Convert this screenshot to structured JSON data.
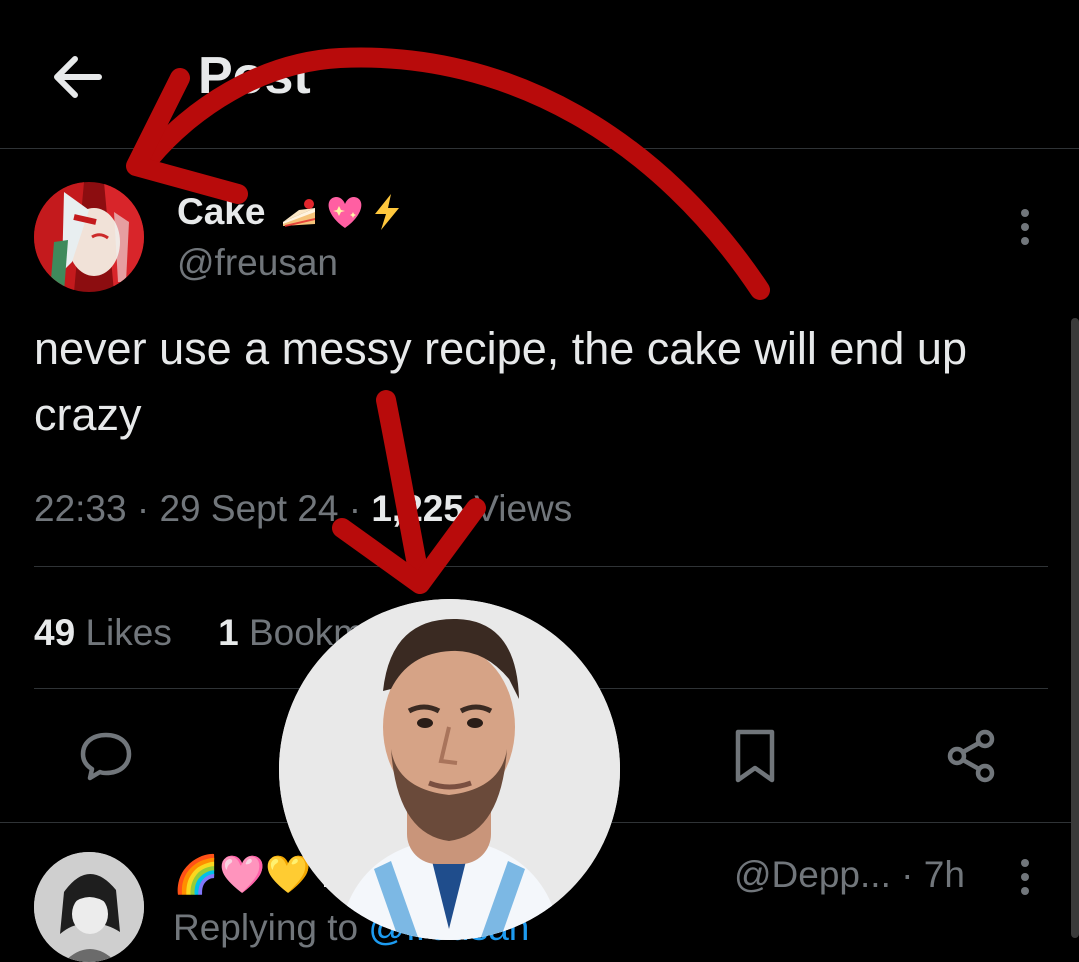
{
  "header": {
    "title": "Post"
  },
  "post": {
    "author_name": "Cake",
    "author_emojis": [
      "🍰",
      "💖",
      "⚡"
    ],
    "author_handle": "@freusan",
    "text": "never use a messy recipe, the cake will end up crazy",
    "time": "22:33",
    "date": "29 Sept 24",
    "views_count": "1,225",
    "views_label": "Views",
    "likes_count": "49",
    "likes_label": "Likes",
    "bookmarks_count": "1",
    "bookmarks_label": "Bookmark"
  },
  "reply": {
    "name": "🌈🩷💛 ...kie☀️🍪",
    "handle": "@Depp...",
    "age": "7h",
    "replying_prefix": "Replying to",
    "replying_handle": "@freusan"
  },
  "colors": {
    "background": "#000000",
    "text": "#e7e9ea",
    "muted": "#71767b",
    "divider": "#2f3336",
    "link": "#1d9bf0",
    "annotation_red": "#c00000"
  }
}
